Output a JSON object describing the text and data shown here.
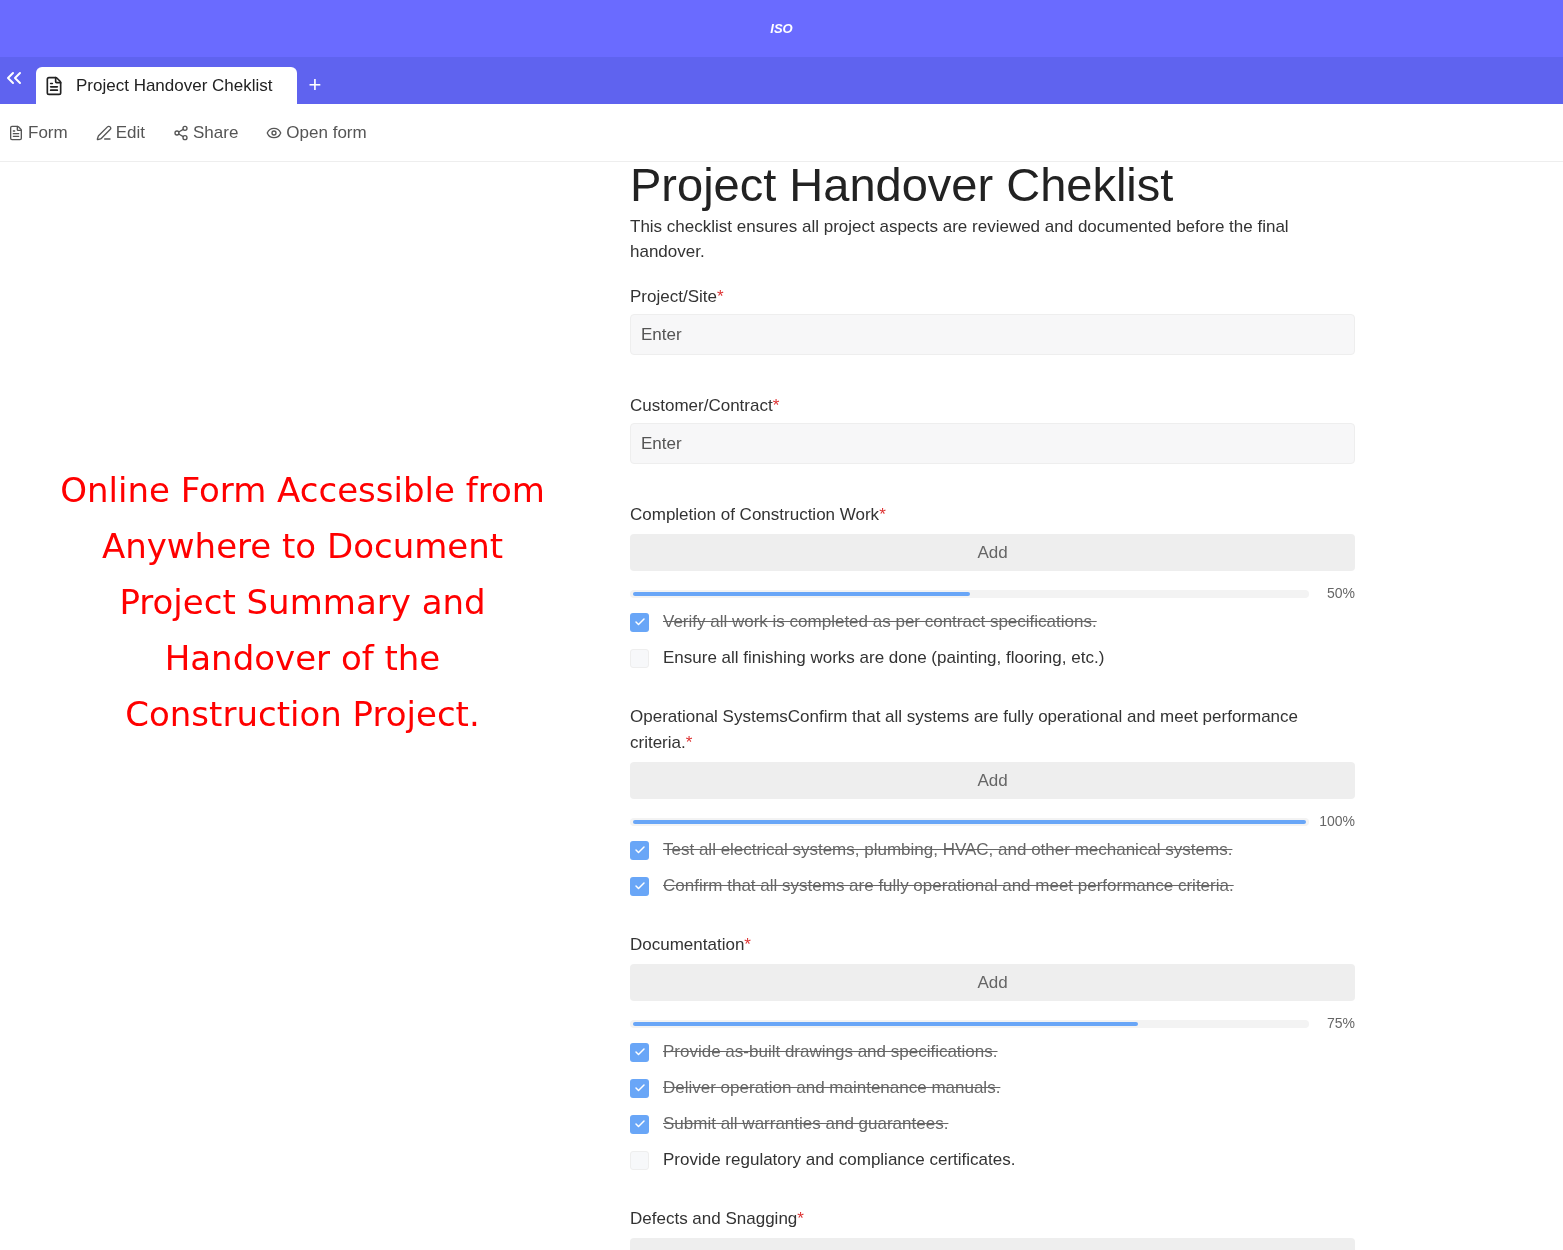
{
  "header": {
    "logo": "ISO"
  },
  "tabs": [
    {
      "label": "Project Handover Cheklist",
      "selected": true
    }
  ],
  "new_tab": "+",
  "toolbar": [
    {
      "kind": "form",
      "label": "Form"
    },
    {
      "kind": "edit",
      "label": "Edit"
    },
    {
      "kind": "share",
      "label": "Share"
    },
    {
      "kind": "eye",
      "label": "Open form"
    }
  ],
  "annotation": "Online Form Accessible from Anywhere to Document Project Summary and Handover of the Construction Project.",
  "form": {
    "title": "Project Handover Cheklist",
    "description": "This checklist ensures all project aspects are reviewed and documented before the final handover.",
    "fields": [
      {
        "kind": "text",
        "label": "Project/Site",
        "required_mark": "*",
        "placeholder": "Enter"
      },
      {
        "kind": "text",
        "label": "Customer/Contract",
        "required_mark": "*",
        "placeholder": "Enter"
      },
      {
        "kind": "checklist",
        "label": "Completion of Construction Work",
        "required_mark": "*",
        "add": "Add",
        "level": 0.5,
        "reading": "50%",
        "items": [
          {
            "label": "Verify all work is completed as per contract specifications.",
            "checked": true
          },
          {
            "label": "Ensure all finishing works are done (painting, flooring, etc.)",
            "checked": false
          }
        ]
      },
      {
        "kind": "checklist",
        "label": "Operational SystemsConfirm that all systems are fully operational and meet performance criteria.",
        "required_mark": "*",
        "add": "Add",
        "level": 1,
        "reading": "100%",
        "items": [
          {
            "label": "Test all electrical systems, plumbing, HVAC, and other mechanical systems.",
            "checked": true
          },
          {
            "label": "Confirm that all systems are fully operational and meet performance criteria.",
            "checked": true
          }
        ]
      },
      {
        "kind": "checklist",
        "label": "Documentation",
        "required_mark": "*",
        "add": "Add",
        "level": 0.75,
        "reading": "75%",
        "items": [
          {
            "label": "Provide as-built drawings and specifications.",
            "checked": true
          },
          {
            "label": "Deliver operation and maintenance manuals.",
            "checked": true
          },
          {
            "label": "Submit all warranties and guarantees.",
            "checked": true
          },
          {
            "label": "Provide regulatory and compliance certificates.",
            "checked": false
          }
        ]
      },
      {
        "kind": "checklist",
        "label": "Defects and Snagging",
        "required_mark": "*"
      }
    ]
  }
}
